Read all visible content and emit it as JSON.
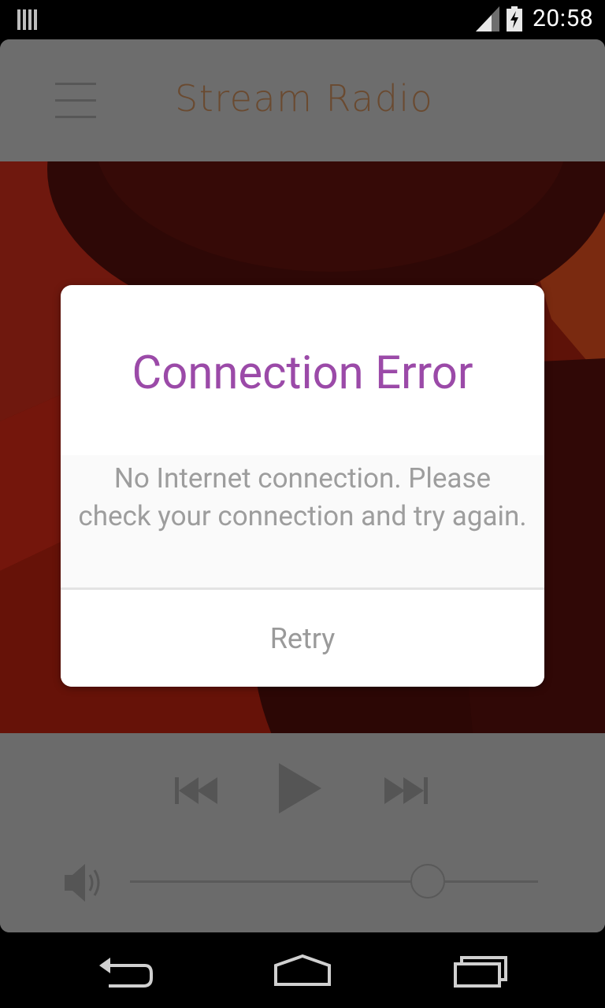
{
  "status_bar": {
    "time": "20:58",
    "icons": [
      "notification-bars-icon",
      "signal-icon",
      "battery-charging-icon"
    ]
  },
  "app": {
    "title": "Stream Radio",
    "menu_icon": "hamburger-menu-icon",
    "controls": {
      "prev_icon": "skip-previous-icon",
      "play_icon": "play-icon",
      "next_icon": "skip-next-icon",
      "volume_icon": "volume-icon",
      "volume_level": 0.73
    }
  },
  "dialog": {
    "title": "Connection Error",
    "message": "No Internet connection. Please check your connection and try again.",
    "retry_label": "Retry"
  },
  "nav_bar": {
    "icons": [
      "back-icon",
      "home-icon",
      "recents-icon"
    ]
  },
  "colors": {
    "dialog_title": "#9b4aa8",
    "dialog_text": "#9d9d9d",
    "app_title": "#6a4a30",
    "artwork_red": "#7a1a10"
  }
}
